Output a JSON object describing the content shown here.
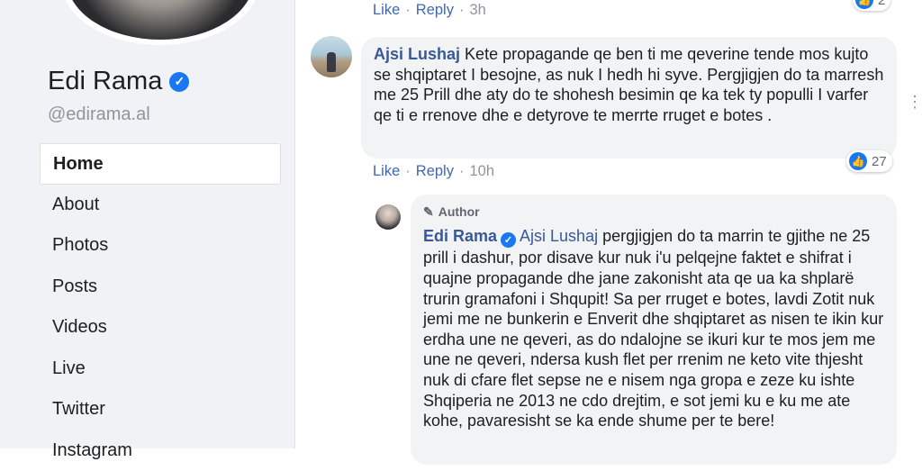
{
  "profile": {
    "name": "Edi Rama",
    "handle": "@edirama.al",
    "verified_symbol": "✓"
  },
  "nav": {
    "items": [
      {
        "label": "Home",
        "active": true
      },
      {
        "label": "About"
      },
      {
        "label": "Photos"
      },
      {
        "label": "Posts"
      },
      {
        "label": "Videos"
      },
      {
        "label": "Live"
      },
      {
        "label": "Twitter"
      },
      {
        "label": "Instagram"
      }
    ]
  },
  "top_actions": {
    "like": "Like",
    "reply": "Reply",
    "time": "3h",
    "reaction_count": "2"
  },
  "comments": [
    {
      "author": "Ajsi Lushaj",
      "text": "Kete propagande qe ben ti me qeverine tende mos kujto se shqiptaret I besojne, as nuk I hedh hi syve. Pergjigjen do ta marresh me 25 Prill dhe aty do te shohesh besimin qe ka tek ty populli I varfer qe ti e rrenove dhe e detyrove te merrte rruget e botes .",
      "like": "Like",
      "reply": "Reply",
      "time": "10h",
      "reaction_count": "27"
    },
    {
      "tag": "Author",
      "author": "Edi Rama",
      "mention": "Ajsi Lushaj",
      "text": "pergjigjen do ta marrin te gjithe ne 25 prill i dashur, por disave kur nuk i'u pelqejne faktet e shifrat i quajne propagande dhe jane zakonisht ata qe ua ka shplarë trurin gramafoni i Shqupit! Sa per rruget e botes, lavdi Zotit nuk jemi me ne bunkerin e Enverit dhe shqiptaret as nisen te ikin kur erdha une ne qeveri, as do ndalojne se ikuri kur te mos jem me une ne qeveri, ndersa kush flet per rrenim ne keto vite thjesht nuk di cfare flet sepse ne e nisem nga gropa e zeze ku ishte Shqiperia ne 2013 ne cdo drejtim, e sot jemi ku e ku me ate kohe, pavaresisht se ka ende shume per te bere!"
    }
  ],
  "icons": {
    "like": "👍",
    "pencil": "✎",
    "more": "⋮",
    "sep": "·"
  },
  "colors": {
    "link": "#385898",
    "action": "#4267b2",
    "verified": "#1877f2",
    "sidebar_bg": "#f0f2f5",
    "bubble_bg": "#f2f3f5"
  }
}
